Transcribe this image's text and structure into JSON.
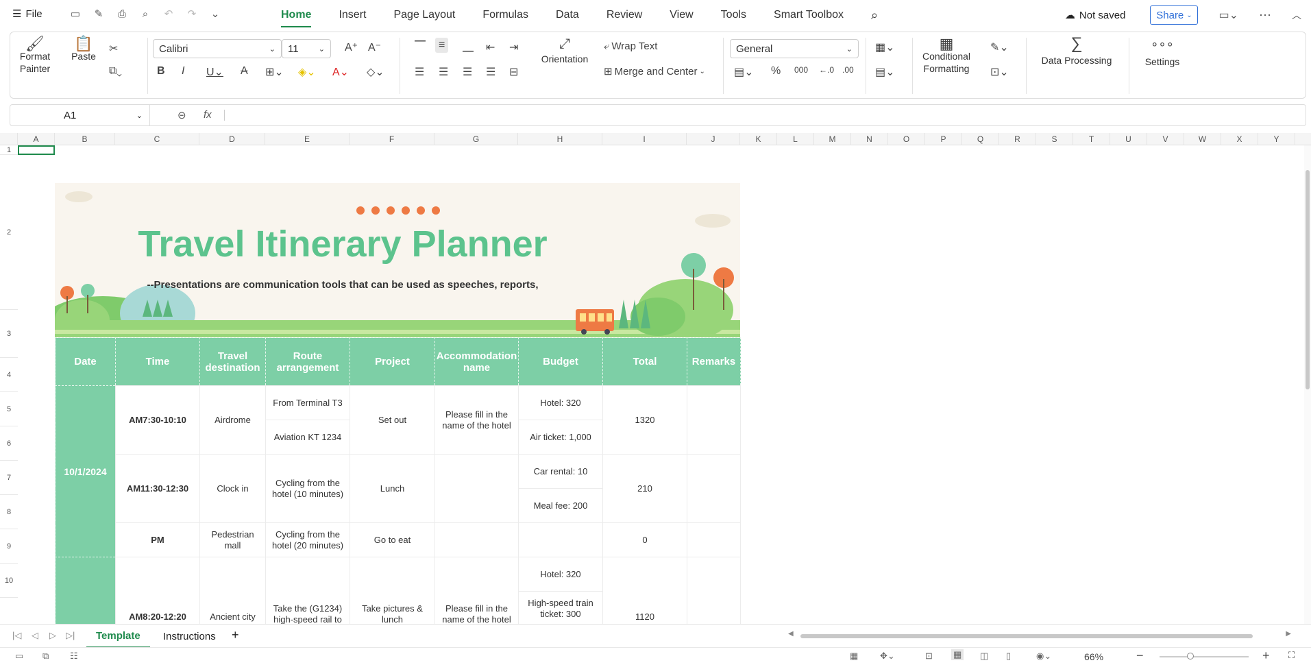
{
  "menu": {
    "file_label": "File"
  },
  "tabs": [
    "Home",
    "Insert",
    "Page Layout",
    "Formulas",
    "Data",
    "Review",
    "View",
    "Tools",
    "Smart Toolbox"
  ],
  "topright": {
    "status": "Not saved",
    "share": "Share"
  },
  "ribbon": {
    "format_painter": "Format Painter",
    "paste": "Paste",
    "font_name": "Calibri",
    "font_size": "11",
    "wrap_text": "Wrap Text",
    "merge_center": "Merge and Center",
    "orientation": "Orientation",
    "number_format": "General",
    "conditional_formatting": "Conditional Formatting",
    "data_processing": "Data Processing",
    "settings": "Settings"
  },
  "formula_bar": {
    "cell_ref": "A1",
    "fx": "fx",
    "value": ""
  },
  "columns": [
    "A",
    "B",
    "C",
    "D",
    "E",
    "F",
    "G",
    "H",
    "I",
    "J",
    "K",
    "L",
    "M",
    "N",
    "O",
    "P",
    "Q",
    "R",
    "S",
    "T",
    "U",
    "V",
    "W",
    "X",
    "Y"
  ],
  "rows": [
    "1",
    "2",
    "3",
    "4",
    "5",
    "6",
    "7",
    "8",
    "9",
    "10"
  ],
  "banner": {
    "title": "Travel Itinerary Planner",
    "subtitle": "--Presentations are communication tools that can be used as speeches, reports,"
  },
  "table": {
    "headers": [
      "Date",
      "Time",
      "Travel destination",
      "Route arrangement",
      "Project",
      "Accommodation name",
      "Budget",
      "Total",
      "Remarks"
    ],
    "date1": "10/1/2024",
    "r1": {
      "time": "AM7:30-10:10",
      "dest": "Airdrome",
      "route_a": "From Terminal T3",
      "route_b": "Aviation KT 1234",
      "project": "Set out",
      "accom": "Please fill in the name of the hotel",
      "budget_a": "Hotel: 320",
      "budget_b": "Air ticket: 1,000",
      "total": "1320"
    },
    "r2": {
      "time": "AM11:30-12:30",
      "dest": "Clock in",
      "route": "Cycling from the hotel (10 minutes)",
      "project": "Lunch",
      "budget_a": "Car rental: 10",
      "budget_b": "Meal fee: 200",
      "total": "210"
    },
    "r3": {
      "time": "PM",
      "dest": "Pedestrian mall",
      "route": "Cycling from the hotel (20 minutes)",
      "project": "Go to eat",
      "total": "0"
    },
    "r4": {
      "time": "AM8:20-12:20",
      "dest": "Ancient city",
      "route": "Take the (G1234) high-speed rail to",
      "project": "Take pictures & lunch",
      "accom": "Please fill in the name of the hotel",
      "budget_a": "Hotel: 320",
      "budget_b": "High-speed train ticket: 300",
      "total": "1120"
    }
  },
  "sheets": [
    "Template",
    "Instructions"
  ],
  "status": {
    "zoom": "66%"
  },
  "colors": {
    "accent": "#1e8a4c",
    "table_header": "#7dcfa6",
    "title_green": "#5cc38d"
  }
}
